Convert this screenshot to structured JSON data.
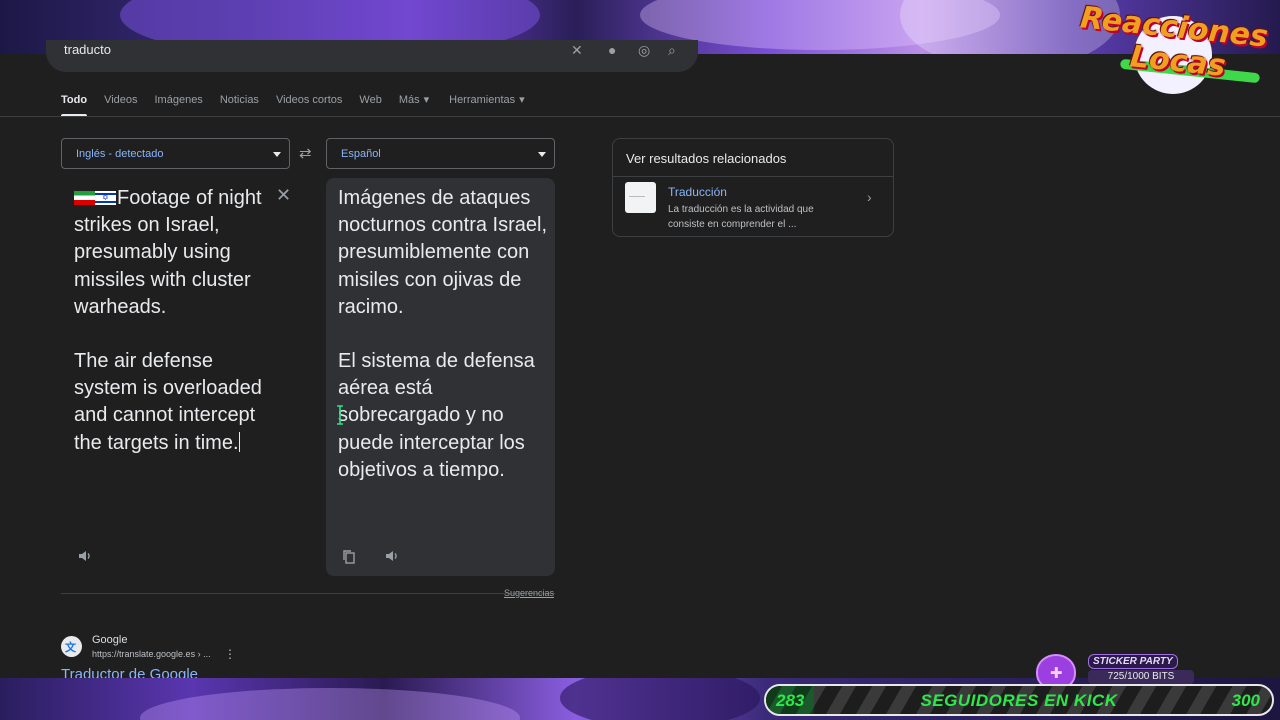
{
  "overlay": {
    "logo_line1": "Reacciones",
    "logo_line2": "Locas",
    "sticker_label": "STICKER PARTY",
    "sticker_bits": "725/1000 BITS",
    "sticker_progress": 0.725,
    "goal_current": "283",
    "goal_label": "SEGUIDORES EN KICK",
    "goal_max": "300"
  },
  "search": {
    "query": "traducto"
  },
  "tabs": [
    "Todo",
    "Videos",
    "Imágenes",
    "Noticias",
    "Videos cortos",
    "Web",
    "Más",
    "Herramientas"
  ],
  "translator": {
    "source_lang": "Inglés - detectado",
    "target_lang": "Español",
    "source_text_1": "Footage of night strikes on Israel, presumably using missiles with cluster warheads.",
    "source_text_2": "The air defense system is overloaded and cannot intercept the targets in time.",
    "target_text_1": "Imágenes de ataques nocturnos contra Israel, presumiblemente con misiles con ojivas de racimo.",
    "target_text_2": "El sistema de defensa aérea está sobrecargado y no puede interceptar los objetivos a tiempo.",
    "suggestions_link": "Sugerencias"
  },
  "related": {
    "title": "Ver resultados relacionados",
    "item_name": "Traducción",
    "item_desc": "La traducción es la actividad que consiste en comprender el ..."
  },
  "result": {
    "site": "Google",
    "url": "https://translate.google.es › ...",
    "title": "Traductor de Google"
  }
}
